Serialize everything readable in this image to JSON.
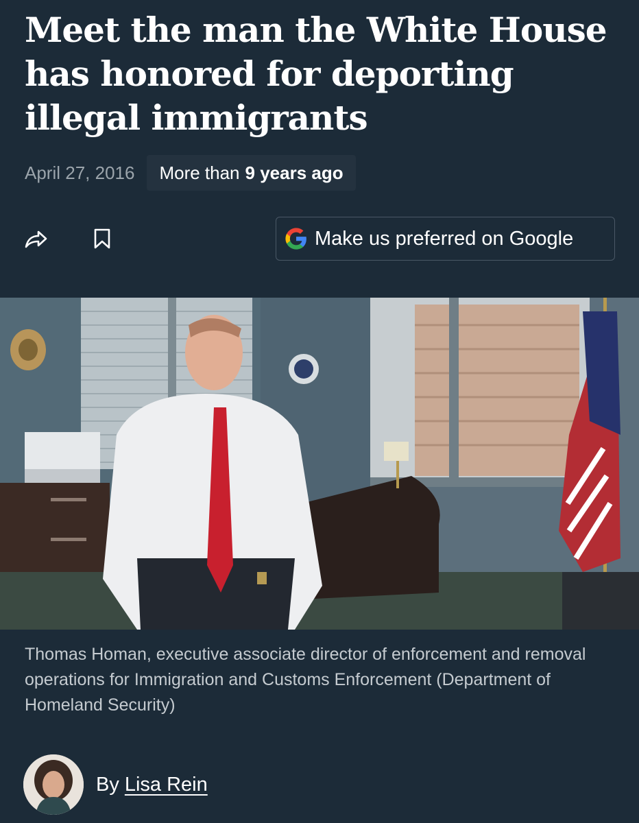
{
  "article": {
    "headline": "Meet the man the White House has honored for deporting illegal immigrants",
    "date": "April 27, 2016",
    "age_prefix": "More than",
    "age_value": "9 years ago"
  },
  "actions": {
    "share_icon": "share-arrow-icon",
    "bookmark_icon": "bookmark-icon",
    "google_label": "Make us preferred on Google",
    "google_icon": "google-g-icon"
  },
  "photo": {
    "caption": "Thomas Homan, executive associate director of enforcement and removal operations for Immigration and Customs Enforcement (Department of Homeland Security)"
  },
  "byline": {
    "prefix": "By",
    "author": "Lisa Rein"
  },
  "colors": {
    "background": "#1c2b38",
    "chip": "#24323f",
    "date_text": "#9ba4ab",
    "caption_text": "#c5cbd0"
  }
}
